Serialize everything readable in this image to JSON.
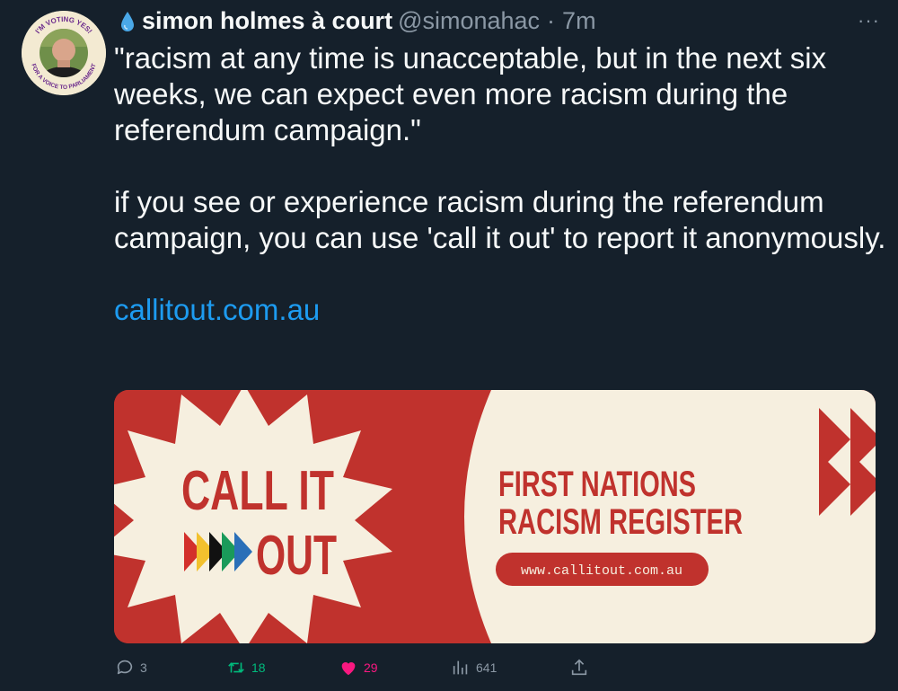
{
  "tweet": {
    "author_name": "simon holmes à court",
    "handle": "@simonahac",
    "separator": "·",
    "time": "7m",
    "more_label": "···",
    "paragraph1": "\"racism at any time is unacceptable, but in the next six weeks, we can expect even more racism during the referendum campaign.\"",
    "paragraph2": "if you see or experience racism during the referendum campaign, you can use 'call it out' to report it anonymously.",
    "link": "callitout.com.au",
    "avatar": {
      "badge_top": "I'M VOTING YES!",
      "badge_bottom": "FOR A VOICE TO PARLIAMENT"
    }
  },
  "card": {
    "logo_line1": "CALL IT",
    "logo_line2": "OUT",
    "headline_line1": "FIRST NATIONS",
    "headline_line2": "RACISM REGISTER",
    "url_pill": "www.callitout.com.au",
    "colors": {
      "red": "#c0322d",
      "cream": "#f6efdf"
    }
  },
  "actions": {
    "replies": "3",
    "retweets": "18",
    "likes": "29",
    "views": "641"
  },
  "icons": [
    "water-drop-icon",
    "more-icon",
    "reply-icon",
    "retweet-icon",
    "heart-icon",
    "views-icon",
    "share-icon"
  ]
}
